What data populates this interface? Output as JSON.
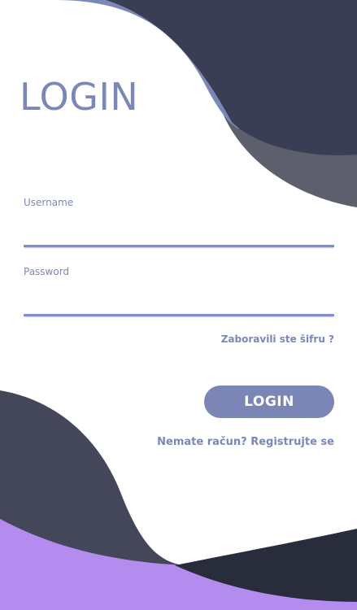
{
  "title": "LOGIN",
  "form": {
    "username": {
      "label": "Username",
      "value": "",
      "placeholder": ""
    },
    "password": {
      "label": "Password",
      "value": "",
      "placeholder": ""
    },
    "forgot_password": "Zaboravili ste šifru ?",
    "login_button": "LOGIN",
    "register_prompt": "Nemate račun? Registrujte se"
  },
  "colors": {
    "accent": "#7b85b6",
    "dark_wave": "#3b3f56",
    "light_wave": "#7b87b7",
    "purple_wave": "#b48cf0",
    "background": "#ffffff"
  }
}
